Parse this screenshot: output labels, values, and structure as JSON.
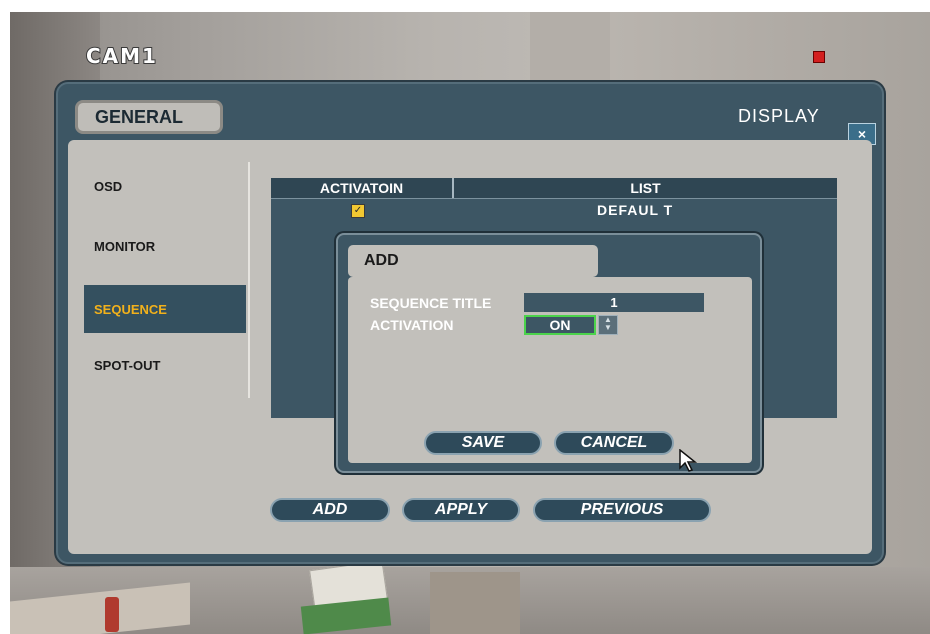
{
  "camera": {
    "label": "CAM1",
    "rec_color": "#d31f1f"
  },
  "dialog": {
    "tab_label": "GENERAL",
    "title": "DISPLAY",
    "close_icon": "close-icon",
    "close_glyph": "×"
  },
  "sidebar": {
    "items": [
      {
        "label": "OSD"
      },
      {
        "label": "MONITOR"
      },
      {
        "label": "SEQUENCE",
        "active": true
      },
      {
        "label": "SPOT-OUT"
      }
    ]
  },
  "table": {
    "columns": [
      "ACTIVATOIN",
      "LIST"
    ],
    "rows": [
      {
        "activation": true,
        "list": "DEFAUL T"
      }
    ]
  },
  "add_dialog": {
    "title": "ADD",
    "sequence_title_label": "SEQUENCE TITLE",
    "sequence_title_value": "1",
    "activation_label": "ACTIVATION",
    "activation_value": "ON",
    "save_label": "SAVE",
    "cancel_label": "CANCEL"
  },
  "footer": {
    "add_label": "ADD",
    "apply_label": "APPLY",
    "previous_label": "PREVIOUS"
  },
  "colors": {
    "panel_dark": "#3d5664",
    "panel_light": "#c2c0bb",
    "active_text": "#f2b11b",
    "focus": "#4bd34b"
  }
}
